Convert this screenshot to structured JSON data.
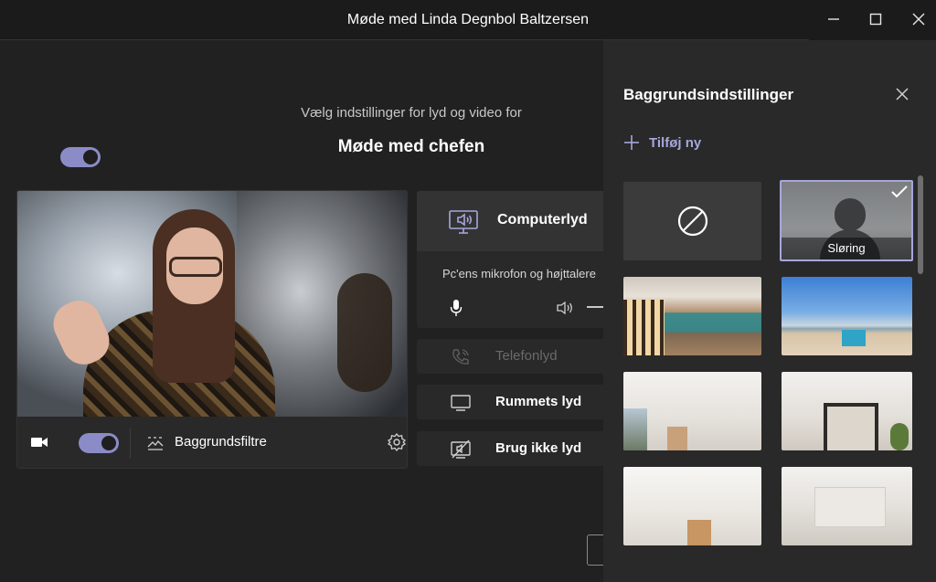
{
  "window": {
    "title": "Møde med Linda Degnbol Baltzersen",
    "controls": [
      "minimize-icon",
      "maximize-icon",
      "close-icon"
    ]
  },
  "prejoin": {
    "subtitle": "Vælg indstillinger for lyd og video for",
    "meeting_title": "Møde med chefen",
    "video": {
      "camera_on": true,
      "background_filters_label": "Baggrundsfiltre",
      "icons": [
        "camera-icon",
        "background-effects-icon",
        "gear-icon"
      ]
    },
    "audio": {
      "selected_option": "Computerlyd",
      "description": "Pc'ens mikrofon og højttalere",
      "mic_on": true,
      "options": [
        {
          "label": "Computerlyd",
          "icon": "monitor-speaker-icon",
          "enabled": true
        },
        {
          "label": "Telefonlyd",
          "icon": "phone-icon",
          "enabled": false
        },
        {
          "label": "Rummets lyd",
          "icon": "room-display-icon",
          "enabled": true
        },
        {
          "label": "Brug ikke lyd",
          "icon": "no-audio-icon",
          "enabled": true
        }
      ]
    }
  },
  "background_panel": {
    "title": "Baggrundsindstillinger",
    "add_new_label": "Tilføj ny",
    "selected": "Sløring",
    "tiles": [
      {
        "type": "none",
        "icon": "no-background-icon"
      },
      {
        "type": "blur",
        "label": "Sløring",
        "selected": true
      },
      {
        "type": "image",
        "scene": "office"
      },
      {
        "type": "image",
        "scene": "beach"
      },
      {
        "type": "image",
        "scene": "room"
      },
      {
        "type": "image",
        "scene": "room"
      },
      {
        "type": "image",
        "scene": "room"
      },
      {
        "type": "image",
        "scene": "room"
      }
    ]
  },
  "colors": {
    "accent": "#8b8cc7",
    "accent_text": "#a6a7dc",
    "background": "#1f1f1f",
    "panel": "#292929"
  }
}
